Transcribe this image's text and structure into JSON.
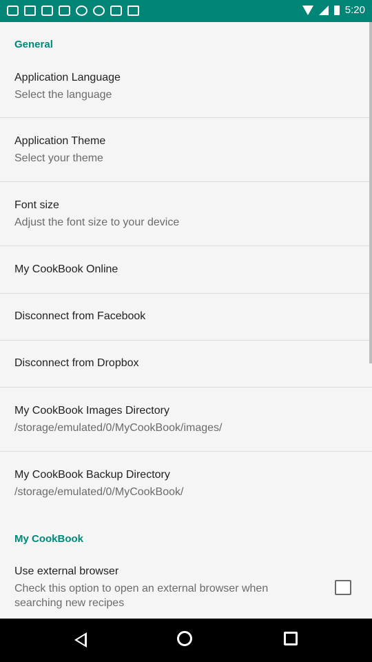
{
  "status_bar": {
    "time": "5:20"
  },
  "sections": {
    "general": "General",
    "mycookbook": "My CookBook"
  },
  "items": [
    {
      "title": "Application Language",
      "summary": "Select the language"
    },
    {
      "title": "Application Theme",
      "summary": "Select your theme"
    },
    {
      "title": "Font size",
      "summary": "Adjust the font size to your device"
    },
    {
      "title": "My CookBook Online"
    },
    {
      "title": "Disconnect from Facebook"
    },
    {
      "title": "Disconnect from Dropbox"
    },
    {
      "title": "My CookBook Images Directory",
      "summary": "/storage/emulated/0/MyCookBook/images/"
    },
    {
      "title": "My CookBook Backup Directory",
      "summary": "/storage/emulated/0/MyCookBook/"
    }
  ],
  "external_browser": {
    "title": "Use external browser",
    "summary_line1": "Check this option to open an external browser when",
    "summary_line2": "searching new recipes",
    "checked": false
  },
  "colors": {
    "accent": "#00897b",
    "statusbar": "#008577"
  }
}
